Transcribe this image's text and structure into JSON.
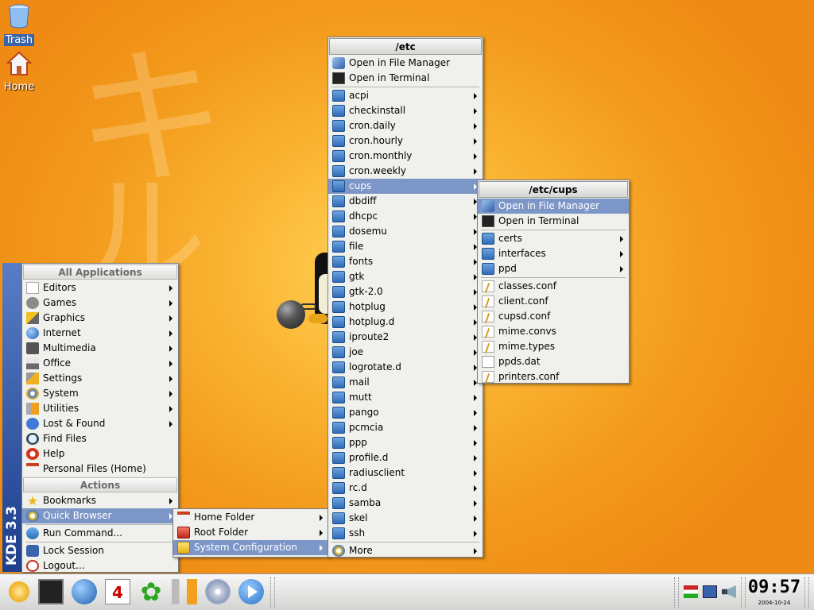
{
  "desktop": {
    "icons": [
      {
        "label": "Trash"
      },
      {
        "label": "Home"
      }
    ],
    "wallpaper_glyphs": [
      "キ",
      "ル"
    ]
  },
  "kmenu": {
    "sidebar_label": "KDE 3.3",
    "all_apps_title": "All Applications",
    "apps": [
      {
        "label": "Editors",
        "icon": "pencil-icon"
      },
      {
        "label": "Games",
        "icon": "gamepad-icon"
      },
      {
        "label": "Graphics",
        "icon": "brush-icon"
      },
      {
        "label": "Internet",
        "icon": "globe-icon"
      },
      {
        "label": "Multimedia",
        "icon": "speaker-icon"
      },
      {
        "label": "Office",
        "icon": "printer-icon"
      },
      {
        "label": "Settings",
        "icon": "wrench-icon"
      },
      {
        "label": "System",
        "icon": "gear-icon"
      },
      {
        "label": "Utilities",
        "icon": "toolbox-icon"
      },
      {
        "label": "Lost & Found",
        "icon": "question-icon"
      }
    ],
    "plain": [
      {
        "label": "Find Files",
        "icon": "magnifier-icon"
      },
      {
        "label": "Help",
        "icon": "lifebuoy-icon"
      },
      {
        "label": "Personal Files (Home)",
        "icon": "home-icon"
      }
    ],
    "actions_title": "Actions",
    "actions": [
      {
        "label": "Bookmarks",
        "icon": "star-icon"
      },
      {
        "label": "Quick Browser",
        "icon": "quick-browser-icon"
      }
    ],
    "run": {
      "label": "Run Command..."
    },
    "session": [
      {
        "label": "Lock Session",
        "icon": "lock-icon"
      },
      {
        "label": "Logout...",
        "icon": "logout-icon"
      }
    ]
  },
  "quick_browser": {
    "items": [
      {
        "label": "Home Folder"
      },
      {
        "label": "Root Folder"
      },
      {
        "label": "System Configuration"
      }
    ]
  },
  "etc_menu": {
    "title": "/etc",
    "open_fm": "Open in File Manager",
    "open_term": "Open in Terminal",
    "folders": [
      "acpi",
      "checkinstall",
      "cron.daily",
      "cron.hourly",
      "cron.monthly",
      "cron.weekly",
      "cups",
      "dbdiff",
      "dhcpc",
      "dosemu",
      "file",
      "fonts",
      "gtk",
      "gtk-2.0",
      "hotplug",
      "hotplug.d",
      "iproute2",
      "joe",
      "logrotate.d",
      "mail",
      "mutt",
      "pango",
      "pcmcia",
      "ppp",
      "profile.d",
      "radiusclient",
      "rc.d",
      "samba",
      "skel",
      "ssh"
    ],
    "more": "More"
  },
  "cups_menu": {
    "title": "/etc/cups",
    "open_fm": "Open in File Manager",
    "open_term": "Open in Terminal",
    "folders": [
      "certs",
      "interfaces",
      "ppd"
    ],
    "files": [
      "classes.conf",
      "client.conf",
      "cupsd.conf",
      "mime.convs",
      "mime.types",
      "ppds.dat",
      "printers.conf"
    ]
  },
  "taskbar": {
    "clock": "09:57",
    "date": "2004-10-24",
    "calendar_day": "4"
  }
}
